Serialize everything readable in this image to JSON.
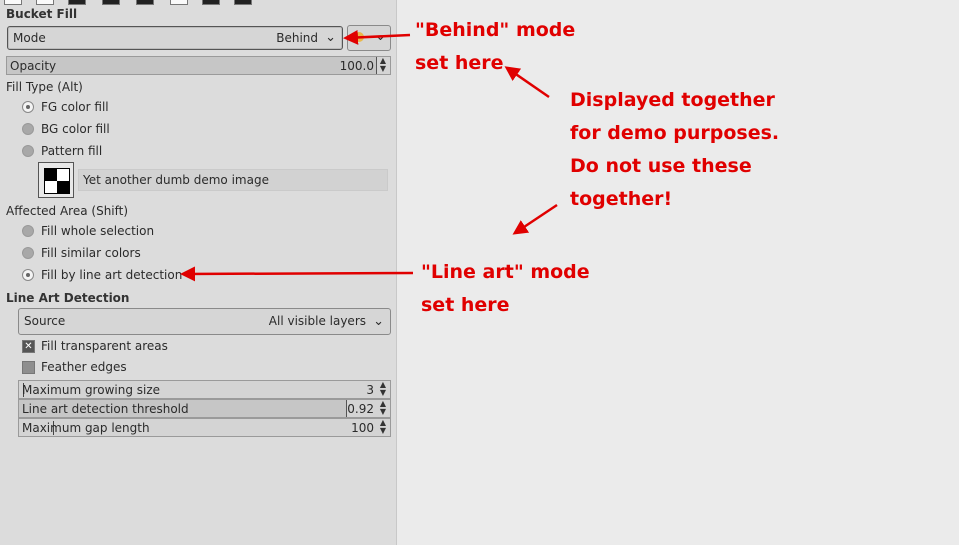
{
  "panel": {
    "title": "Bucket Fill",
    "mode": {
      "label": "Mode",
      "value": "Behind"
    },
    "opacity": {
      "label": "Opacity",
      "value": "100.0"
    },
    "fill_type": {
      "heading": "Fill Type  (Alt)",
      "options": [
        {
          "label": "FG color fill",
          "selected": true
        },
        {
          "label": "BG color fill",
          "selected": false
        },
        {
          "label": "Pattern fill",
          "selected": false
        }
      ],
      "pattern_name": "Yet another dumb demo image"
    },
    "affected_area": {
      "heading": "Affected Area  (Shift)",
      "options": [
        {
          "label": "Fill whole selection",
          "selected": false
        },
        {
          "label": "Fill similar colors",
          "selected": false
        },
        {
          "label": "Fill by line art detection",
          "selected": true
        }
      ]
    },
    "line_art": {
      "heading": "Line Art Detection",
      "source": {
        "label": "Source",
        "value": "All visible layers"
      },
      "fill_transparent": {
        "label": "Fill transparent areas",
        "checked": true
      },
      "feather_edges": {
        "label": "Feather edges",
        "checked": false
      },
      "max_growing": {
        "label": "Maximum growing size",
        "value": "3"
      },
      "threshold": {
        "label": "Line art detection threshold",
        "value": "0.92",
        "fraction": 0.92
      },
      "max_gap": {
        "label": "Maximum gap length",
        "value": "100"
      }
    }
  },
  "annotations": {
    "behind": [
      "\"Behind\" mode",
      "set here"
    ],
    "demo": [
      "Displayed together",
      "for demo purposes.",
      "Do not use these",
      "together!"
    ],
    "lineart": [
      "\"Line art\" mode",
      "set here"
    ],
    "color": "#e00000"
  }
}
